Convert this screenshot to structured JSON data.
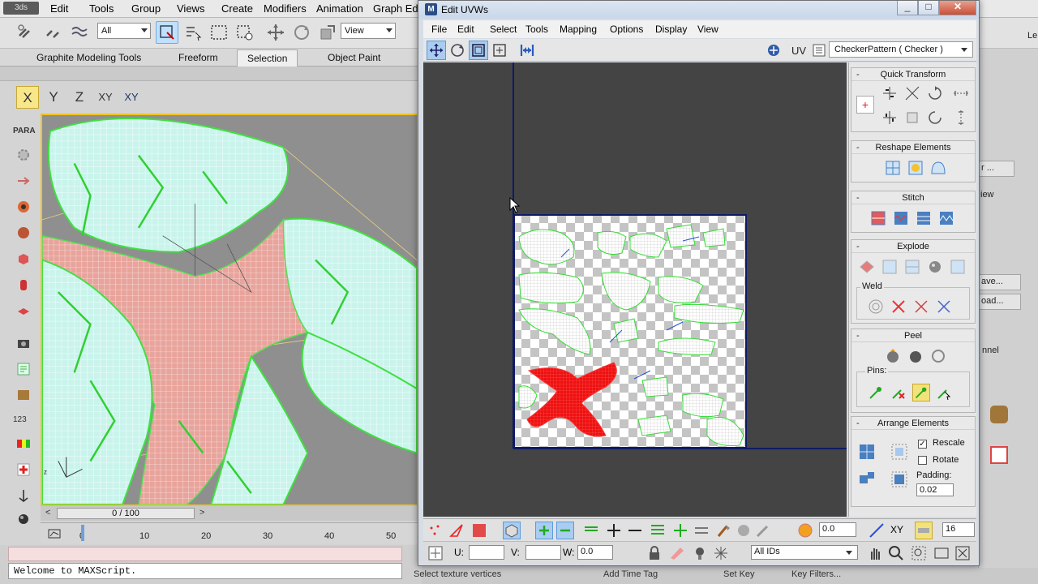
{
  "max": {
    "logo": "3ds",
    "menu": [
      "Edit",
      "Tools",
      "Group",
      "Views",
      "Create",
      "Modifiers",
      "Animation",
      "Graph Edit"
    ],
    "toolbar": {
      "selection_filter": "All",
      "ref_coord": "View"
    },
    "ribbon_tabs": [
      "Graphite Modeling Tools",
      "Freeform",
      "Selection",
      "Object Paint"
    ],
    "ribbon_active": "Selection",
    "axis": [
      "X",
      "Y",
      "Z",
      "XY",
      "XY"
    ],
    "left_labels": {
      "para": "PARA",
      "num": "123"
    },
    "time_slider": "0 / 100",
    "ticks": [
      "0",
      "10",
      "20",
      "30",
      "40",
      "50"
    ],
    "script_text": "Welcome to MAXScript.",
    "status_prompt": "Select texture vertices",
    "add_time_tag": "Add Time Tag",
    "set_key": "Set Key",
    "key_filters": "Key Filters...",
    "right_fragments": [
      "r ...",
      "iew",
      "ave...",
      "oad...",
      "nnel",
      "Le"
    ]
  },
  "uvw": {
    "title": "Edit UVWs",
    "icon_letter": "M",
    "menu": [
      "File",
      "Edit",
      "Select",
      "Tools",
      "Mapping",
      "Options",
      "Display",
      "View"
    ],
    "uv_label": "UV",
    "map_combo": "CheckerPattern  ( Checker )",
    "rollouts": {
      "quick_transform": "Quick Transform",
      "reshape": "Reshape Elements",
      "stitch": "Stitch",
      "explode": "Explode",
      "weld": "Weld",
      "peel": "Peel",
      "pins": "Pins:",
      "arrange": "Arrange Elements",
      "rescale": "Rescale",
      "rotate": "Rotate",
      "padding_label": "Padding:",
      "padding_value": "0.02"
    },
    "bottom": {
      "spin_value": "0.0",
      "xy_label": "XY",
      "grid_value": "16",
      "u_label": "U:",
      "v_label": "V:",
      "w_label": "W:",
      "w_value": "0.0",
      "ids_combo": "All IDs"
    }
  },
  "colors": {
    "selection_red": "#ee1111",
    "uv_green": "#33dd33",
    "viewport_border": "#f0c322",
    "axis_active": "#f8e68a",
    "mesh_cyan": "#c9f4ec",
    "mesh_pink": "#e8a49c"
  }
}
